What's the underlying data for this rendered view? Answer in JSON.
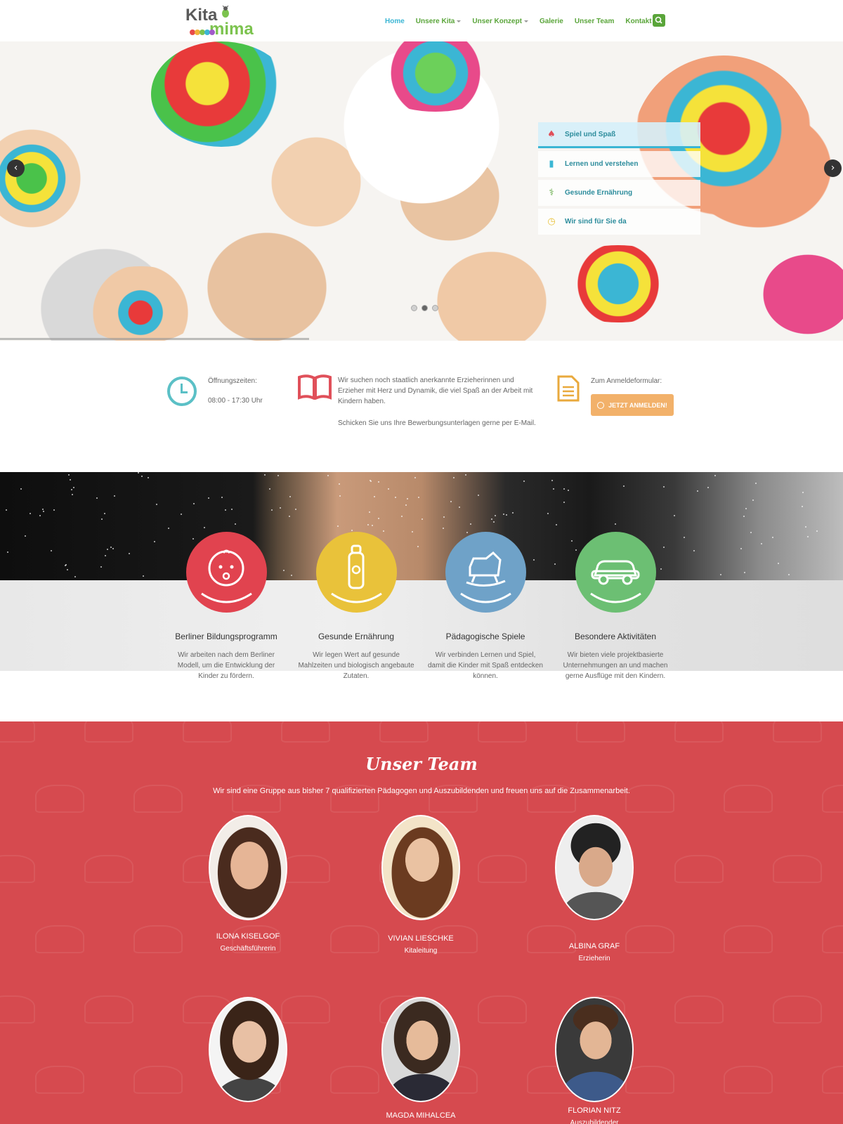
{
  "header": {
    "logo": {
      "line1": "Kita",
      "line2": "mima"
    },
    "nav": [
      {
        "label": "Home",
        "active": true,
        "dropdown": false
      },
      {
        "label": "Unsere Kita",
        "active": false,
        "dropdown": true
      },
      {
        "label": "Unser Konzept",
        "active": false,
        "dropdown": true
      },
      {
        "label": "Galerie",
        "active": false,
        "dropdown": false
      },
      {
        "label": "Unser Team",
        "active": false,
        "dropdown": false
      },
      {
        "label": "Kontakt",
        "active": false,
        "dropdown": true
      }
    ],
    "search_icon": "search-icon",
    "colors": {
      "nav": "#5aa53a",
      "active": "#3bb6d4"
    }
  },
  "hero": {
    "features": [
      {
        "label": "Spiel und Spaß",
        "icon": "child-icon"
      },
      {
        "label": "Lernen und verstehen",
        "icon": "book-icon"
      },
      {
        "label": "Gesunde Ernährung",
        "icon": "cutlery-icon"
      },
      {
        "label": "Wir sind für Sie da",
        "icon": "clock-icon"
      }
    ],
    "slider": {
      "current_slide": 2,
      "total_slides": 3
    },
    "prev_icon": "chevron-left-icon",
    "next_icon": "chevron-right-icon"
  },
  "info": {
    "hours_label": "Öffnungszeiten:",
    "hours_value": "08:00 - 17:30 Uhr",
    "jobs_text": "Wir suchen noch staatlich anerkannte Erzieherinnen und Erzieher mit Herz und Dynamik, die viel Spaß an der Arbeit mit Kindern haben.",
    "jobs_text2": "Schicken Sie uns Ihre Bewerbungsunterlagen gerne per E-Mail.",
    "form_label": "Zum Anmeldeformular:",
    "register_button": "JETZT ANMELDEN!",
    "colors": {
      "clock": "#5bc0c6",
      "book": "#e0505a",
      "doc": "#e9a93c",
      "button": "#f2b16a"
    }
  },
  "activities": [
    {
      "title": "Berliner Bildungsprogramm",
      "desc": "Wir arbeiten nach dem Berliner Modell, um die Entwicklung der Kinder zu fördern.",
      "icon": "baby-face-icon",
      "color": "#e1434f"
    },
    {
      "title": "Gesunde Ernährung",
      "desc": "Wir legen Wert auf gesunde Mahlzeiten und biologisch angebaute Zutaten.",
      "icon": "baby-bottle-icon",
      "color": "#e9c23a"
    },
    {
      "title": "Pädagogische Spiele",
      "desc": "Wir verbinden Lernen und Spiel, damit die Kinder mit Spaß entdecken können.",
      "icon": "rocking-horse-icon",
      "color": "#6fa2c8"
    },
    {
      "title": "Besondere Aktivitäten",
      "desc": "Wir bieten viele projektbasierte Unternehmungen an und machen gerne Ausflüge mit den Kindern.",
      "icon": "toy-car-icon",
      "color": "#6cbf73"
    }
  ],
  "team": {
    "title": "Unser Team",
    "subtitle": "Wir sind eine Gruppe aus bisher 7 qualifizierten Pädagogen und Auszubildenden und freuen uns auf die Zusammenarbeit.",
    "members": [
      {
        "name": "ILONA KISELGOF",
        "role": "Geschäftsführerin"
      },
      {
        "name": "VIVIAN LIESCHKE",
        "role": "Kitaleitung"
      },
      {
        "name": "ALBINA GRAF",
        "role": "Erzieherin"
      },
      {
        "name": "",
        "role": ""
      },
      {
        "name": "MAGDA MIHALCEA",
        "role": ""
      },
      {
        "name": "FLORIAN NITZ",
        "role": "Auszubildender"
      }
    ],
    "color": "#d64a4f"
  }
}
